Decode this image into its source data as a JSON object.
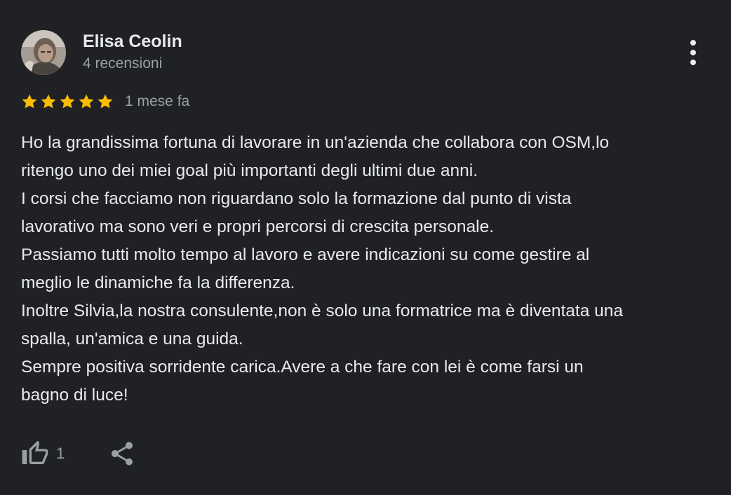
{
  "review": {
    "author_name": "Elisa Ceolin",
    "author_meta": "4 recensioni",
    "rating": 5,
    "date": "1 mese fa",
    "text_lines": [
      "Ho la grandissima fortuna di lavorare in un'azienda che collabora con OSM,lo",
      "ritengo uno dei miei goal più importanti degli ultimi due anni.",
      "I corsi che facciamo non riguardano solo la formazione dal punto di vista",
      "lavorativo ma sono veri e propri percorsi di crescita personale.",
      "Passiamo tutti molto tempo al lavoro e avere indicazioni su come gestire al",
      "meglio le dinamiche fa la differenza.",
      "Inoltre Silvia,la nostra consulente,non è solo una formatrice ma è diventata una",
      "spalla, un'amica e una guida.",
      "Sempre positiva sorridente carica.Avere a che fare con lei è come farsi un",
      "bagno di luce!"
    ],
    "like_count": "1"
  },
  "icons": {
    "more": "more-vert-icon",
    "star": "star-icon",
    "like": "thumb-up-icon",
    "share": "share-icon"
  },
  "colors": {
    "background": "#202124",
    "primary_text": "#e8eaed",
    "secondary_text": "#9aa0a6",
    "star": "#fbbc04"
  }
}
